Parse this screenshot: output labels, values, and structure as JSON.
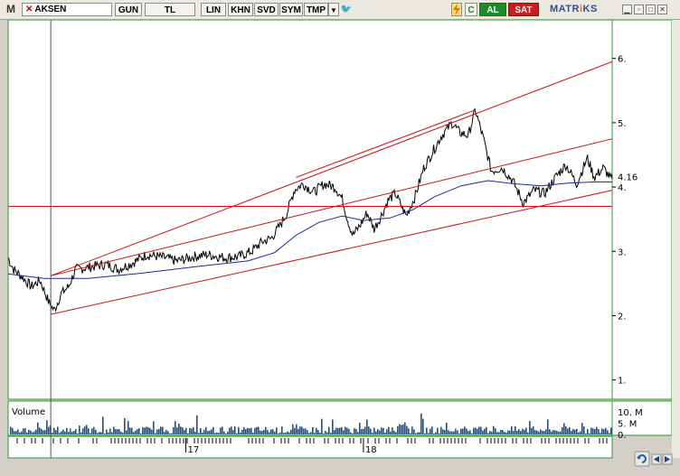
{
  "toolbar": {
    "logo": "M",
    "symbol": "AKSEN",
    "symbol_clear": "✕",
    "buttons": [
      "GUN",
      "TL",
      "LIN",
      "KHN",
      "SVD",
      "SYM",
      "TMP"
    ],
    "dropdown": "▼",
    "twitter": "🐦",
    "buy": "AL",
    "sell": "SAT",
    "brand_left": "MATR",
    "brand_dot": "i",
    "brand_right": "KS",
    "refresh_icon": "refresh-icon",
    "c_label": "C"
  },
  "colors": {
    "price": "#000000",
    "moving_average": "#1a2a9a",
    "channel": "#cc1111",
    "volume": "#1e4f8c",
    "panel_border": "#2e9a2e"
  },
  "chart_data": {
    "type": "line",
    "symbol": "AKSEN",
    "y_ticks": [
      {
        "value": 6.0,
        "label": "6."
      },
      {
        "value": 5.0,
        "label": "5."
      },
      {
        "value": 4.0,
        "label": "4."
      },
      {
        "value": 3.0,
        "label": "3."
      },
      {
        "value": 2.0,
        "label": "2."
      },
      {
        "value": 1.0,
        "label": "1."
      }
    ],
    "last_price": 4.16,
    "last_price_label": "4.16",
    "ylim": [
      0.7,
      6.6
    ],
    "x_range": [
      2016.0,
      2018.72
    ],
    "x_ticks": [
      {
        "value": 2017.0,
        "label": "17"
      },
      {
        "value": 2018.0,
        "label": "18"
      }
    ],
    "price_keypoints": [
      [
        2016.0,
        2.9
      ],
      [
        2016.03,
        2.72
      ],
      [
        2016.08,
        2.6
      ],
      [
        2016.13,
        2.45
      ],
      [
        2016.18,
        2.55
      ],
      [
        2016.23,
        2.2
      ],
      [
        2016.26,
        2.08
      ],
      [
        2016.3,
        2.35
      ],
      [
        2016.34,
        2.45
      ],
      [
        2016.38,
        2.72
      ],
      [
        2016.45,
        2.75
      ],
      [
        2016.55,
        2.8
      ],
      [
        2016.62,
        2.72
      ],
      [
        2016.7,
        2.82
      ],
      [
        2016.78,
        2.95
      ],
      [
        2016.88,
        2.9
      ],
      [
        2016.95,
        2.85
      ],
      [
        2017.05,
        2.92
      ],
      [
        2017.12,
        2.95
      ],
      [
        2017.22,
        2.9
      ],
      [
        2017.3,
        2.92
      ],
      [
        2017.37,
        3.0
      ],
      [
        2017.43,
        3.15
      ],
      [
        2017.48,
        3.2
      ],
      [
        2017.53,
        3.4
      ],
      [
        2017.57,
        3.6
      ],
      [
        2017.61,
        3.95
      ],
      [
        2017.66,
        4.05
      ],
      [
        2017.72,
        3.92
      ],
      [
        2017.78,
        4.05
      ],
      [
        2017.84,
        4.0
      ],
      [
        2017.88,
        3.82
      ],
      [
        2017.91,
        3.5
      ],
      [
        2017.94,
        3.25
      ],
      [
        2017.98,
        3.4
      ],
      [
        2018.02,
        3.6
      ],
      [
        2018.06,
        3.35
      ],
      [
        2018.1,
        3.55
      ],
      [
        2018.14,
        3.8
      ],
      [
        2018.18,
        3.9
      ],
      [
        2018.24,
        3.55
      ],
      [
        2018.29,
        3.85
      ],
      [
        2018.34,
        4.3
      ],
      [
        2018.39,
        4.55
      ],
      [
        2018.44,
        4.8
      ],
      [
        2018.5,
        5.0
      ],
      [
        2018.54,
        4.85
      ],
      [
        2018.59,
        4.8
      ],
      [
        2018.63,
        5.2
      ],
      [
        2018.68,
        4.7
      ],
      [
        2018.72,
        4.25
      ]
    ],
    "price_keypoints_2": [
      [
        2018.72,
        4.25
      ],
      [
        2018.78,
        4.3
      ],
      [
        2018.84,
        4.1
      ],
      [
        2018.9,
        3.75
      ],
      [
        2018.96,
        3.95
      ],
      [
        2019.02,
        3.9
      ],
      [
        2019.08,
        4.15
      ],
      [
        2019.14,
        4.35
      ],
      [
        2019.2,
        4.05
      ],
      [
        2019.26,
        4.45
      ],
      [
        2019.3,
        4.15
      ],
      [
        2019.35,
        4.3
      ],
      [
        2019.4,
        4.1
      ]
    ],
    "moving_average_keypoints": [
      [
        2016.0,
        2.65
      ],
      [
        2016.2,
        2.58
      ],
      [
        2016.45,
        2.58
      ],
      [
        2016.75,
        2.66
      ],
      [
        2017.05,
        2.76
      ],
      [
        2017.35,
        2.85
      ],
      [
        2017.5,
        2.98
      ],
      [
        2017.62,
        3.25
      ],
      [
        2017.75,
        3.45
      ],
      [
        2017.88,
        3.55
      ],
      [
        2018.0,
        3.48
      ],
      [
        2018.15,
        3.52
      ],
      [
        2018.28,
        3.65
      ],
      [
        2018.4,
        3.85
      ],
      [
        2018.55,
        4.02
      ],
      [
        2018.7,
        4.1
      ],
      [
        2018.85,
        4.05
      ],
      [
        2019.0,
        4.02
      ],
      [
        2019.15,
        4.06
      ],
      [
        2019.3,
        4.08
      ],
      [
        2019.4,
        4.08
      ]
    ],
    "channel_lines": [
      {
        "from": [
          2016.24,
          2.62
        ],
        "to": [
          2019.4,
          5.95
        ]
      },
      {
        "from": [
          2016.24,
          2.02
        ],
        "to": [
          2019.4,
          3.95
        ]
      },
      {
        "from": [
          2016.24,
          2.62
        ],
        "to": [
          2019.4,
          4.75
        ]
      },
      {
        "from": [
          2017.62,
          4.15
        ],
        "to": [
          2018.63,
          5.2
        ]
      }
    ],
    "horizontal_level": 3.7,
    "vertical_marker": 2016.24,
    "volume_panel": {
      "title": "Volume",
      "y_ticks": [
        {
          "value": 10,
          "label": "10. M"
        },
        {
          "value": 5,
          "label": "5. M"
        },
        {
          "value": 0,
          "label": "0."
        }
      ],
      "ylim": [
        0,
        14
      ]
    }
  }
}
